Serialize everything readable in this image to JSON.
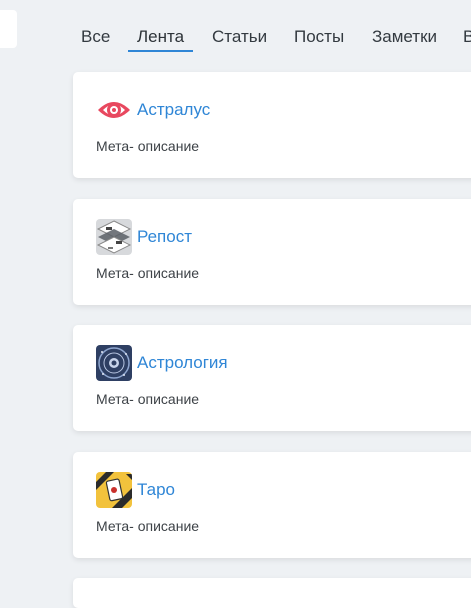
{
  "tabs": [
    {
      "label": "Все"
    },
    {
      "label": "Лента"
    },
    {
      "label": "Статьи"
    },
    {
      "label": "Посты"
    },
    {
      "label": "Заметки"
    },
    {
      "label": "В"
    }
  ],
  "active_tab": "Лента",
  "accent_color": "#2f86d6",
  "cards": [
    {
      "title": "Астралус",
      "meta": "Мета- описание",
      "icon": "eye-logo-icon"
    },
    {
      "title": "Репост",
      "meta": "Мета- описание",
      "icon": "repost-avatar-icon"
    },
    {
      "title": "Астрология",
      "meta": "Мета- описание",
      "icon": "astrology-avatar-icon"
    },
    {
      "title": "Таро",
      "meta": "Мета- описание",
      "icon": "tarot-avatar-icon"
    }
  ]
}
